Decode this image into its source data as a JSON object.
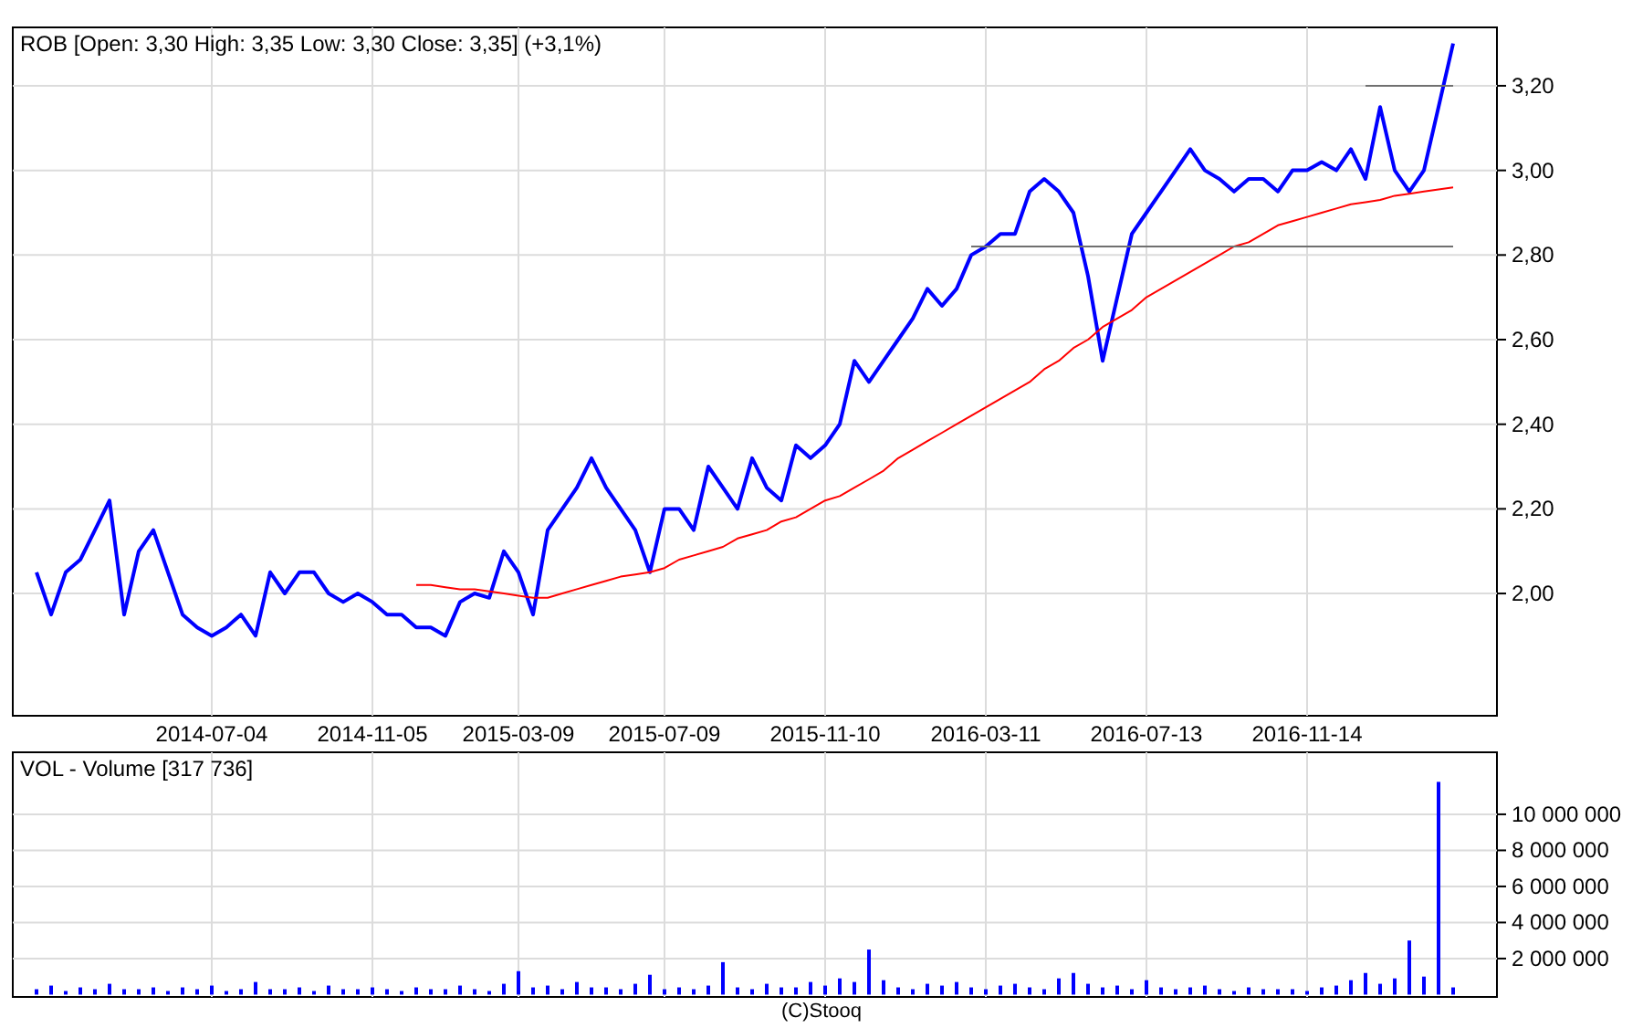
{
  "price_chart": {
    "chart_data": {
      "type": "line",
      "title": "ROB [Open: 3,30  High: 3,35  Low: 3,30  Close: 3,35] (+3,1%)",
      "grid": true,
      "categories": [
        null,
        null,
        null,
        null,
        null,
        null,
        null,
        null,
        null,
        null,
        null,
        null,
        "2014-07-04",
        null,
        null,
        null,
        null,
        null,
        null,
        null,
        null,
        null,
        null,
        "2014-11-05",
        null,
        null,
        null,
        null,
        null,
        null,
        null,
        null,
        null,
        "2015-03-09",
        null,
        null,
        null,
        null,
        null,
        null,
        null,
        null,
        null,
        "2015-07-09",
        null,
        null,
        null,
        null,
        null,
        null,
        null,
        null,
        null,
        null,
        "2015-11-10",
        null,
        null,
        null,
        null,
        null,
        null,
        null,
        null,
        null,
        null,
        "2016-03-11",
        null,
        null,
        null,
        null,
        null,
        null,
        null,
        null,
        null,
        null,
        "2016-07-13",
        null,
        null,
        null,
        null,
        null,
        null,
        null,
        null,
        null,
        null,
        "2016-11-14",
        null,
        null,
        null,
        null,
        null,
        null,
        null,
        null,
        null,
        null
      ],
      "ylim": [
        1.711,
        3.338
      ],
      "yticks": [
        {
          "value": 2.0,
          "label": "2,00"
        },
        {
          "value": 2.2,
          "label": "2,20"
        },
        {
          "value": 2.4,
          "label": "2,40"
        },
        {
          "value": 2.6,
          "label": "2,60"
        },
        {
          "value": 2.8,
          "label": "2,80"
        },
        {
          "value": 3.0,
          "label": "3,00"
        },
        {
          "value": 3.2,
          "label": "3,20"
        }
      ],
      "series": [
        {
          "color": "#0000ff",
          "values": [
            2.05,
            1.95,
            2.05,
            2.08,
            2.15,
            2.22,
            1.95,
            2.1,
            2.15,
            2.05,
            1.95,
            1.92,
            1.9,
            1.92,
            1.95,
            1.9,
            2.05,
            2.0,
            2.05,
            2.05,
            2.0,
            1.98,
            2.0,
            1.98,
            1.95,
            1.95,
            1.92,
            1.92,
            1.9,
            1.98,
            2.0,
            1.99,
            2.1,
            2.05,
            1.95,
            2.15,
            2.2,
            2.25,
            2.32,
            2.25,
            2.2,
            2.15,
            2.05,
            2.2,
            2.2,
            2.15,
            2.3,
            2.25,
            2.2,
            2.32,
            2.25,
            2.22,
            2.35,
            2.32,
            2.35,
            2.4,
            2.55,
            2.5,
            2.55,
            2.6,
            2.65,
            2.72,
            2.68,
            2.72,
            2.8,
            2.82,
            2.85,
            2.85,
            2.95,
            2.98,
            2.95,
            2.9,
            2.75,
            2.55,
            2.7,
            2.85,
            2.9,
            2.95,
            3.0,
            3.05,
            3.0,
            2.98,
            2.95,
            2.98,
            2.98,
            2.95,
            3.0,
            3.0,
            3.02,
            3.0,
            3.05,
            2.98,
            3.15,
            3.0,
            2.95,
            3.0,
            3.15,
            3.3
          ]
        },
        {
          "color": "#ff0000",
          "values": [
            null,
            null,
            null,
            null,
            null,
            null,
            null,
            null,
            null,
            null,
            null,
            null,
            null,
            null,
            null,
            null,
            null,
            null,
            null,
            null,
            null,
            null,
            null,
            null,
            null,
            null,
            2.02,
            2.02,
            2.015,
            2.01,
            2.01,
            2.005,
            2.0,
            1.995,
            1.99,
            1.99,
            2.0,
            2.01,
            2.02,
            2.03,
            2.04,
            2.045,
            2.05,
            2.06,
            2.08,
            2.09,
            2.1,
            2.11,
            2.13,
            2.14,
            2.15,
            2.17,
            2.18,
            2.2,
            2.22,
            2.23,
            2.25,
            2.27,
            2.29,
            2.32,
            2.34,
            2.36,
            2.38,
            2.4,
            2.42,
            2.44,
            2.46,
            2.48,
            2.5,
            2.53,
            2.55,
            2.58,
            2.6,
            2.63,
            2.65,
            2.67,
            2.7,
            2.72,
            2.74,
            2.76,
            2.78,
            2.8,
            2.82,
            2.83,
            2.85,
            2.87,
            2.88,
            2.89,
            2.9,
            2.91,
            2.92,
            2.925,
            2.93,
            2.94,
            2.945,
            2.95,
            2.955,
            2.96
          ]
        },
        {
          "color": "#707070",
          "values": [
            null,
            null,
            null,
            null,
            null,
            null,
            null,
            null,
            null,
            null,
            null,
            null,
            null,
            null,
            null,
            null,
            null,
            null,
            null,
            null,
            null,
            null,
            null,
            null,
            null,
            null,
            null,
            null,
            null,
            null,
            null,
            null,
            null,
            null,
            null,
            null,
            null,
            null,
            null,
            null,
            null,
            null,
            null,
            null,
            null,
            null,
            null,
            null,
            null,
            null,
            null,
            null,
            null,
            null,
            null,
            null,
            null,
            null,
            null,
            null,
            null,
            null,
            null,
            null,
            2.82,
            2.82,
            2.82,
            2.82,
            2.82,
            2.82,
            2.82,
            2.82,
            2.82,
            2.82,
            2.82,
            2.82,
            2.82,
            2.82,
            2.82,
            2.82,
            2.82,
            2.82,
            2.82,
            2.82,
            2.82,
            2.82,
            2.82,
            2.82,
            2.82,
            2.82,
            2.82,
            2.82,
            2.82,
            2.82,
            2.82,
            2.82,
            2.82,
            2.82
          ]
        },
        {
          "color": "#707070",
          "values": [
            null,
            null,
            null,
            null,
            null,
            null,
            null,
            null,
            null,
            null,
            null,
            null,
            null,
            null,
            null,
            null,
            null,
            null,
            null,
            null,
            null,
            null,
            null,
            null,
            null,
            null,
            null,
            null,
            null,
            null,
            null,
            null,
            null,
            null,
            null,
            null,
            null,
            null,
            null,
            null,
            null,
            null,
            null,
            null,
            null,
            null,
            null,
            null,
            null,
            null,
            null,
            null,
            null,
            null,
            null,
            null,
            null,
            null,
            null,
            null,
            null,
            null,
            null,
            null,
            null,
            null,
            null,
            null,
            null,
            null,
            null,
            null,
            null,
            null,
            null,
            null,
            null,
            null,
            null,
            null,
            null,
            null,
            null,
            null,
            null,
            null,
            null,
            null,
            null,
            null,
            null,
            3.2,
            3.2,
            3.2,
            3.2,
            3.2,
            3.2,
            3.2
          ]
        }
      ]
    }
  },
  "volume_chart": {
    "chart_data": {
      "type": "bar",
      "title": "VOL - Volume [317 736]",
      "grid": true,
      "ylim": [
        -130000,
        13440000
      ],
      "yticks": [
        {
          "value": 2000000,
          "label": "2 000 000"
        },
        {
          "value": 4000000,
          "label": "4 000 000"
        },
        {
          "value": 6000000,
          "label": "6 000 000"
        },
        {
          "value": 8000000,
          "label": "8 000 000"
        },
        {
          "value": 10000000,
          "label": "10 000 000"
        }
      ],
      "series": [
        {
          "color": "#0000ff",
          "values": [
            300000,
            500000,
            200000,
            400000,
            300000,
            600000,
            300000,
            300000,
            400000,
            200000,
            400000,
            300000,
            500000,
            200000,
            300000,
            700000,
            300000,
            300000,
            400000,
            200000,
            500000,
            300000,
            300000,
            400000,
            300000,
            200000,
            400000,
            300000,
            300000,
            500000,
            300000,
            200000,
            600000,
            1300000,
            400000,
            500000,
            300000,
            700000,
            400000,
            400000,
            300000,
            600000,
            1100000,
            300000,
            400000,
            300000,
            500000,
            1800000,
            400000,
            300000,
            600000,
            400000,
            400000,
            700000,
            500000,
            900000,
            700000,
            2500000,
            800000,
            400000,
            300000,
            600000,
            500000,
            700000,
            400000,
            300000,
            500000,
            600000,
            400000,
            300000,
            900000,
            1200000,
            600000,
            400000,
            500000,
            300000,
            800000,
            400000,
            300000,
            400000,
            500000,
            300000,
            200000,
            400000,
            300000,
            300000,
            300000,
            200000,
            400000,
            500000,
            800000,
            1200000,
            600000,
            900000,
            3000000,
            1000000,
            11800000,
            400000
          ]
        }
      ]
    }
  },
  "footer": {
    "text": "(C)Stooq"
  }
}
